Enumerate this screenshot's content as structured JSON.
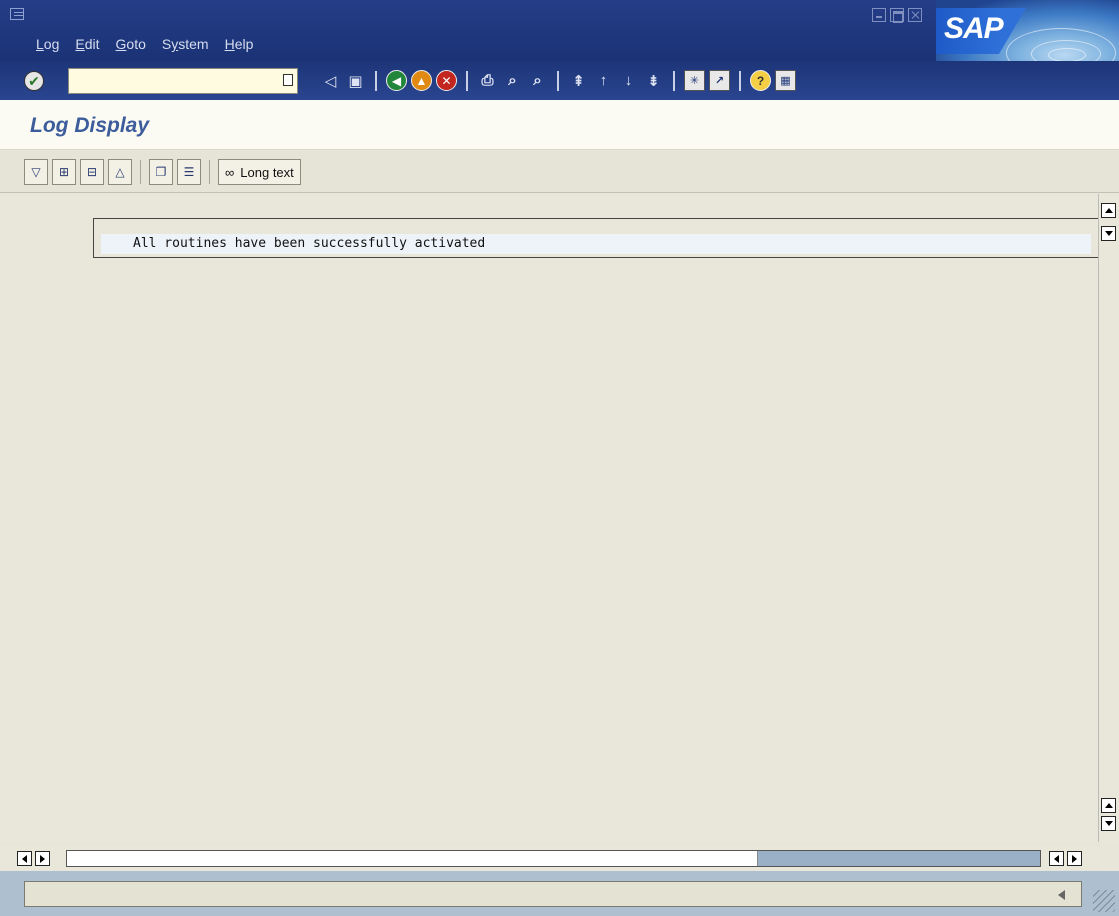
{
  "menubar": {
    "items": [
      {
        "label": "Log",
        "mnemonic": "L"
      },
      {
        "label": "Edit",
        "mnemonic": "E"
      },
      {
        "label": "Goto",
        "mnemonic": "G"
      },
      {
        "label": "System",
        "mnemonic": "y"
      },
      {
        "label": "Help",
        "mnemonic": "H"
      }
    ]
  },
  "branding": {
    "logo_text": "SAP"
  },
  "command_field": {
    "value": "",
    "placeholder": ""
  },
  "page": {
    "title": "Log Display"
  },
  "app_toolbar": {
    "icons": [
      "expand-icon",
      "expand-subtree-icon",
      "collapse-subtree-icon",
      "collapse-icon",
      "details-icon",
      "list-icon"
    ],
    "long_text_label": "Long text"
  },
  "log": {
    "messages": [
      "All routines have been successfully activated"
    ]
  },
  "status": {
    "message": ""
  },
  "scroll": {
    "horizontal_visible_fraction": 0.71
  },
  "colors": {
    "title_bar": "#1b3375",
    "page_title": "#3c5c9c",
    "content_background": "#e9e7d9",
    "status_bar": "#aebfd0"
  }
}
